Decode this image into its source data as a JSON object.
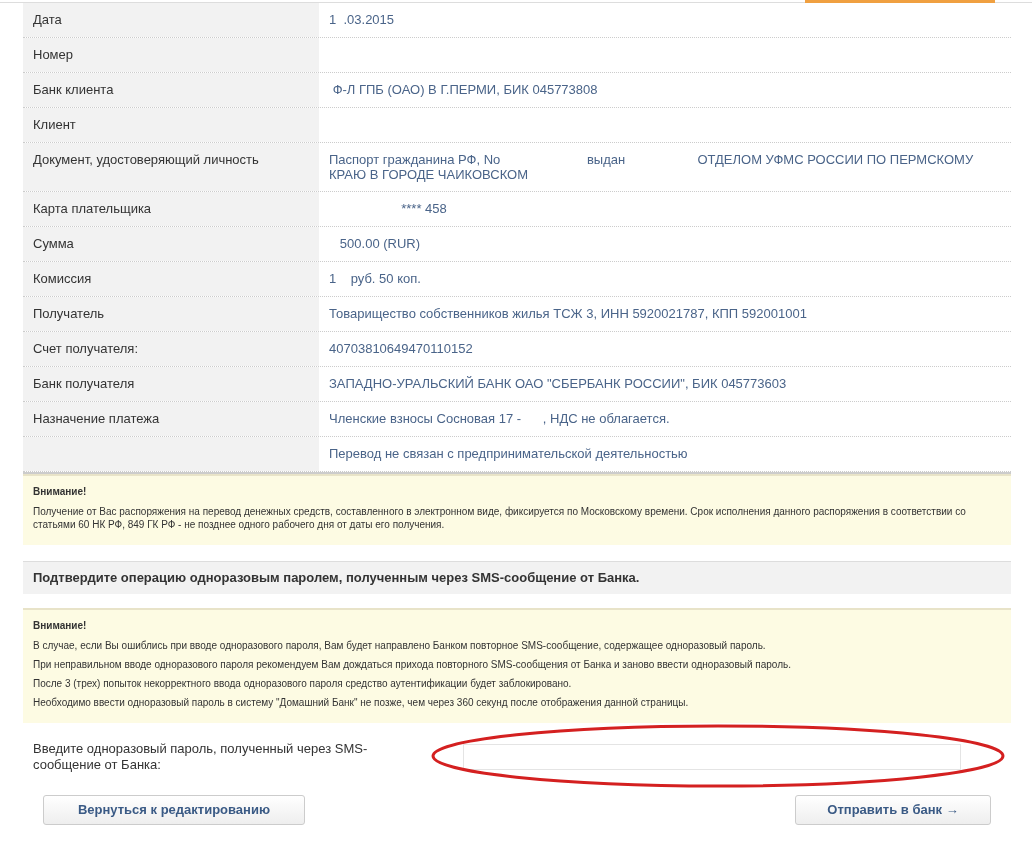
{
  "rows": [
    {
      "label": "Дата",
      "value": "1  .03.2015"
    },
    {
      "label": "Номер"
    },
    {
      "label": "Банк клиента",
      "value": " Ф-Л ГПБ (ОАО) В Г.ПЕРМИ, БИК 045773808"
    },
    {
      "label": "Клиент"
    },
    {
      "label": "Документ, удостоверяющий личность",
      "value": "Паспорт гражданина РФ, No                        выдан                    ОТДЕЛОМ УФМС РОССИИ ПО ПЕРМСКОМУ КРАЮ В ГОРОДЕ ЧАИКОВСКОМ"
    },
    {
      "label": "Карта плательщика",
      "value": "                    **** 458"
    },
    {
      "label": "Сумма",
      "value": "   500.00 (RUR)"
    },
    {
      "label": "Комиссия",
      "value": "1    руб. 50 коп."
    },
    {
      "label": "Получатель",
      "value": "Товарищество собственников жилья ТСЖ 3, ИНН 5920021787, КПП 592001001"
    },
    {
      "label": "Счет получателя:",
      "value": "40703810649470110152"
    },
    {
      "label": "Банк получателя",
      "value": "ЗАПАДНО-УРАЛЬСКИЙ БАНК ОАО \"СБЕРБАНК РОССИИ\", БИК 045773603"
    },
    {
      "label": "Назначение платежа",
      "value": "Членские взносы Сосновая 17 -      , НДС не облагается."
    },
    {
      "label": "",
      "value": "Перевод не связан с предпринимательской деятельностью"
    }
  ],
  "notice1": {
    "title": "Внимание!",
    "lines": [
      "Получение от Вас распоряжения на перевод денежных средств, составленного в электронном виде, фиксируется по Московскому времени. Срок исполнения данного распоряжения в соответствии со статьями 60 НК РФ, 849 ГК РФ - не позднее одного рабочего дня от даты его получения."
    ]
  },
  "confirm_heading": "Подтвердите операцию одноразовым паролем, полученным через SMS-сообщение от Банка.",
  "notice2": {
    "title": "Внимание!",
    "lines": [
      "В случае, если Вы ошиблись при вводе одноразового пароля, Вам будет направлено Банком повторное SMS-сообщение, содержащее одноразовый пароль.",
      "При неправильном вводе одноразового пароля рекомендуем Вам дождаться прихода повторного SMS-сообщения от Банка и заново ввести одноразовый пароль.",
      "После 3 (трех) попыток некорректного ввода одноразового пароля средство аутентификации будет заблокировано.",
      "Необходимо ввести одноразовый пароль в систему \"Домашний Банк\" не позже, чем через 360 секунд после отображения данной страницы."
    ]
  },
  "password_label": "Введите одноразовый пароль, полученный через SMS-сообщение от Банка:",
  "buttons": {
    "back": "Вернуться к редактированию",
    "send": "Отправить в банк →"
  }
}
